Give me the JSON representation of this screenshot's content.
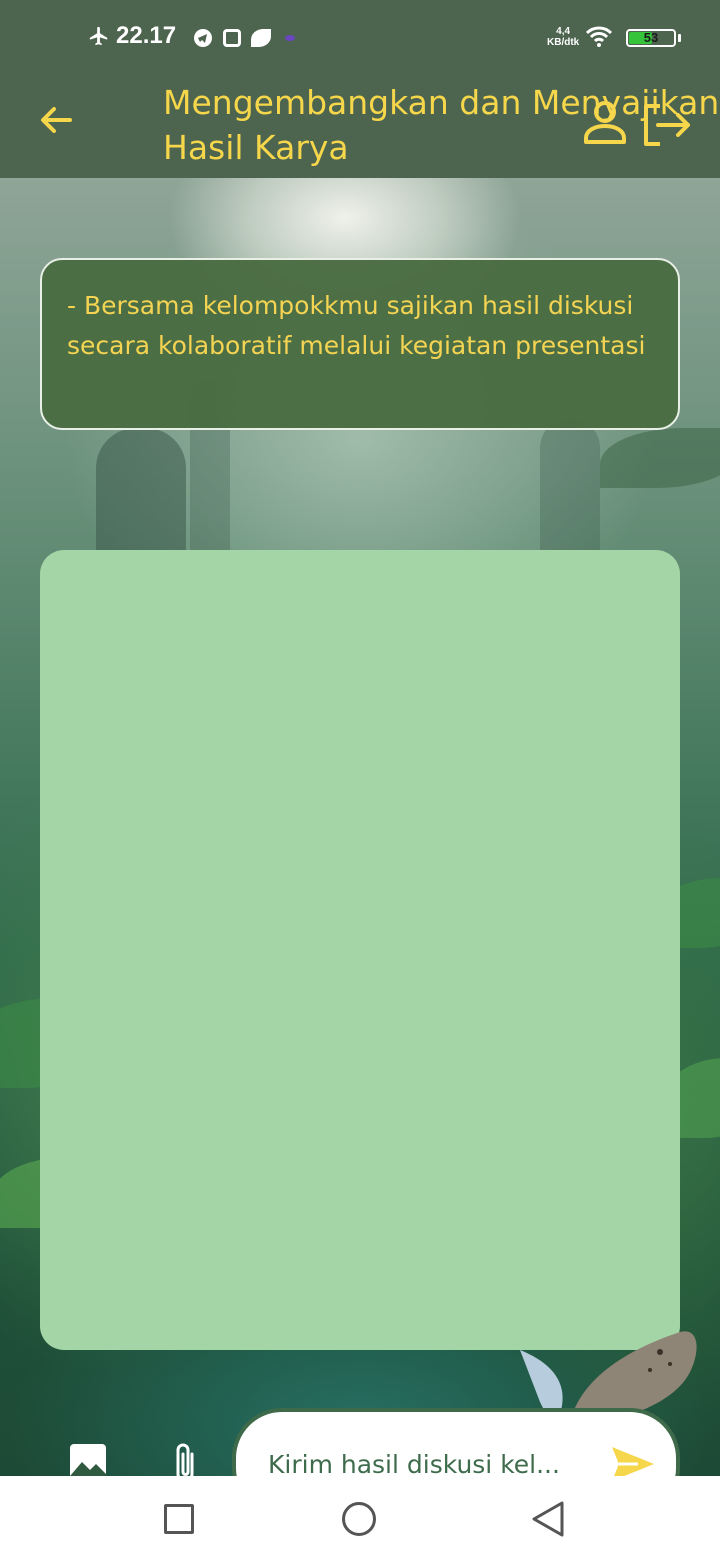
{
  "status_bar": {
    "time": "22.17",
    "network_speed_value": "4,4",
    "network_speed_unit": "KB/dtk",
    "battery": "53",
    "battery_level": 0.53,
    "icons": [
      "airplane-icon",
      "telegram-icon",
      "instagram-icon",
      "leaf-icon",
      "notification-icon",
      "wifi-icon",
      "battery-icon"
    ]
  },
  "app_bar": {
    "title": "Mengembangkan dan Menyajikan\nHasil Karya",
    "back_icon": "arrow-left-icon",
    "profile_icon": "person-icon",
    "logout_icon": "logout-icon"
  },
  "instruction": {
    "text": "- Bersama kelompokkmu sajikan hasil diskusi secara kolaboratif melalui kegiatan presentasi"
  },
  "composer": {
    "input_value": "Kirim hasil diskusi kel...",
    "image_icon": "image-icon",
    "attach_icon": "paperclip-icon",
    "send_icon": "send-icon"
  },
  "colors": {
    "accent": "#f6d64a",
    "app_bar": "#4d644f",
    "card": "#4a6c42",
    "panel": "#a4d5a6",
    "input_border": "#3e6a4a"
  },
  "nav_bar": {
    "icons": [
      "recent-apps-icon",
      "home-icon",
      "back-icon"
    ]
  }
}
